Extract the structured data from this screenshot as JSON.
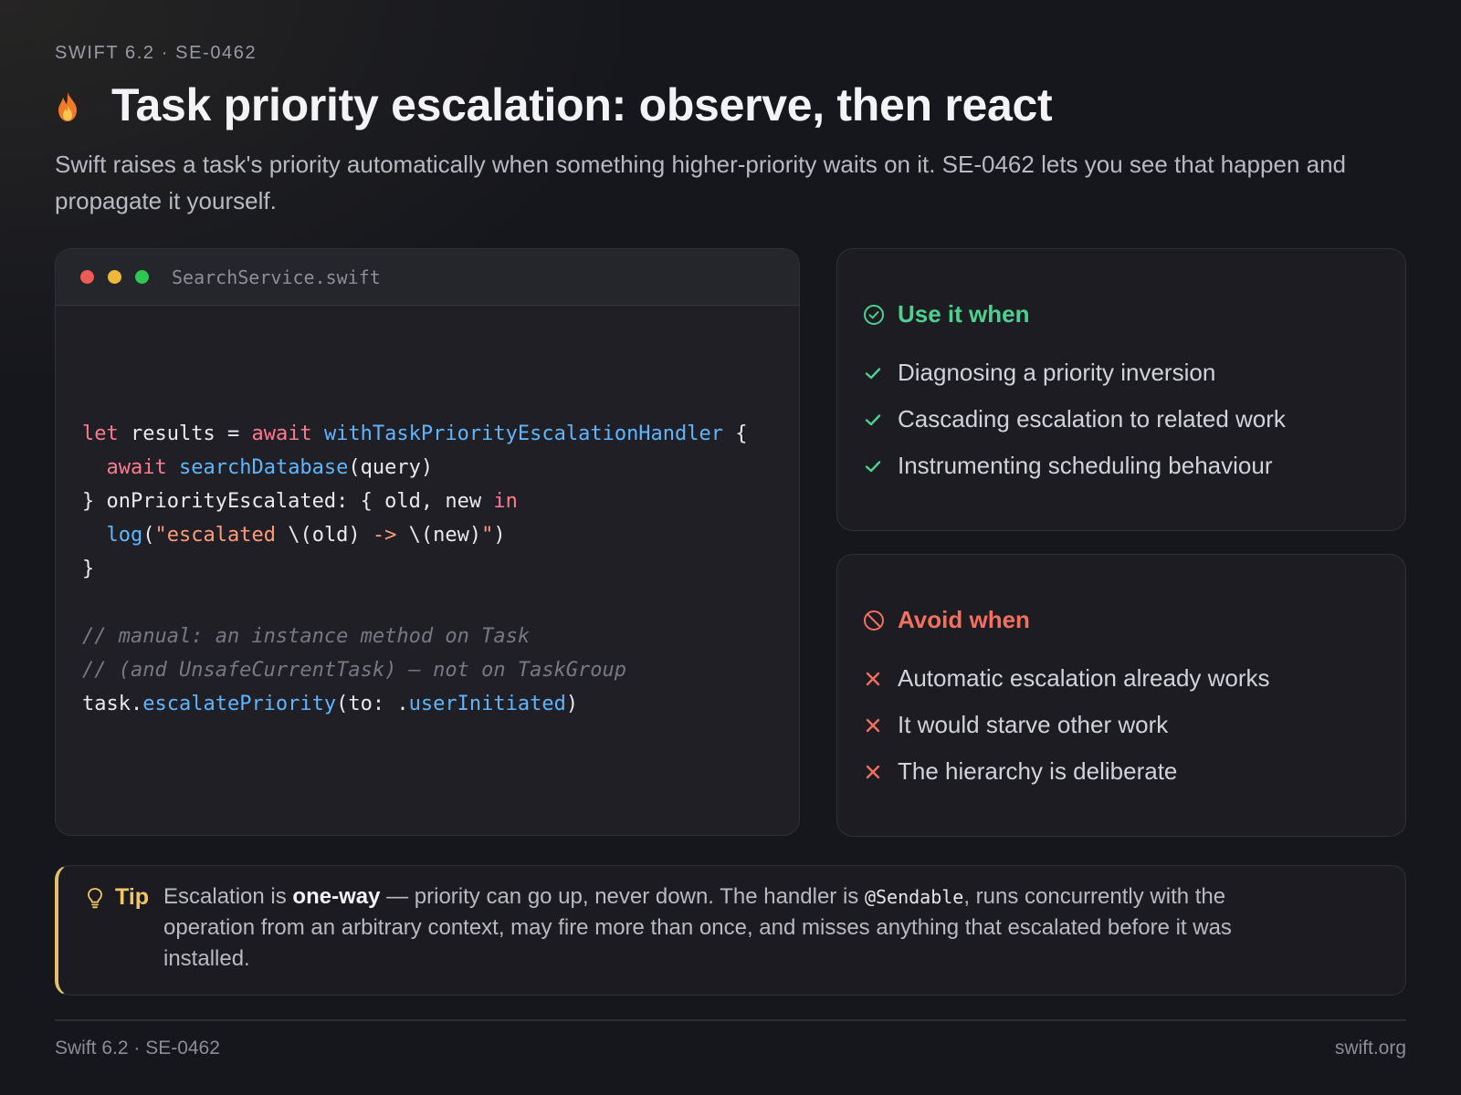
{
  "header": {
    "eyebrow": "SWIFT 6.2 · SE-0462",
    "title": "Task priority escalation: observe, then react",
    "subtitle": "Swift raises a task's priority automatically when something higher-priority waits on it. SE-0462 lets you see that happen and propagate it yourself."
  },
  "code": {
    "filename": "SearchService.swift"
  },
  "use_card": {
    "heading": "Use it when",
    "items": [
      "Diagnosing a priority inversion",
      "Cascading escalation to related work",
      "Instrumenting scheduling behaviour"
    ]
  },
  "avoid_card": {
    "heading": "Avoid when",
    "items": [
      "Automatic escalation already works",
      "It would starve other work",
      "The hierarchy is deliberate"
    ]
  },
  "tip": {
    "label": "Tip",
    "text_before": "Escalation is ",
    "bold": "one-way",
    "text_middle": " — priority can go up, never down. The handler is ",
    "code": "@Sendable",
    "text_after": ", runs concurrently with the operation from an arbitrary context, may fire more than once, and misses anything that escalated before it was installed."
  },
  "footer": {
    "left": "Swift 6.2 · SE-0462",
    "right": "swift.org"
  },
  "colors": {
    "background": "#16171d",
    "use_accent": "#4ed08f",
    "avoid_accent": "#f2705f",
    "tip_accent": "#e2c070",
    "keyword": "#ff7a8e",
    "function": "#5fb6ff"
  },
  "icons": {
    "title": "flame-icon",
    "use": "check-circle-icon",
    "use_item": "checkmark-icon",
    "avoid": "prohibited-icon",
    "avoid_item": "cross-icon",
    "tip": "lightbulb-icon"
  }
}
